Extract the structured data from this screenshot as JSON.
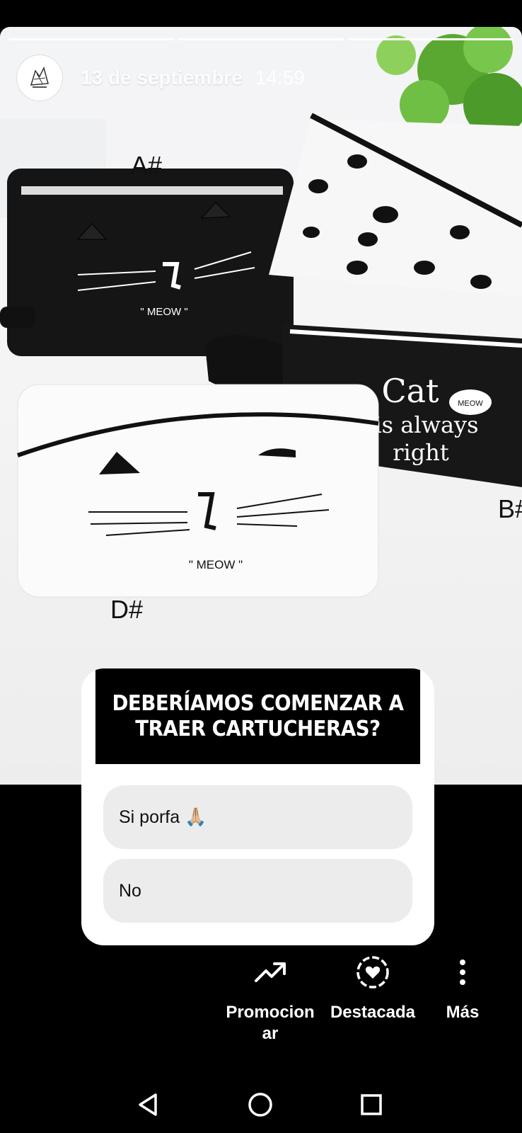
{
  "story": {
    "date": "13 de septiembre",
    "time": "14:59",
    "progress": [
      1.0,
      1.0,
      1.0
    ],
    "labels": {
      "a": "A#",
      "b": "B#",
      "d": "D#"
    },
    "pouch_texts": {
      "meow": "\" MEOW \"",
      "cat_line1": "Cat",
      "cat_line2": "is always",
      "cat_line3": "right",
      "bubble": "MEOW"
    }
  },
  "poll": {
    "question": "DEBERÍAMOS COMENZAR A TRAER CARTUCHERAS?",
    "options": [
      {
        "label": "Si porfa 🙏🏼"
      },
      {
        "label": "No"
      }
    ]
  },
  "actions": {
    "promote": "Promocionar",
    "highlight": "Destacada",
    "more": "Más"
  },
  "colors": {
    "background": "#000000",
    "poll_option": "#ececec"
  }
}
